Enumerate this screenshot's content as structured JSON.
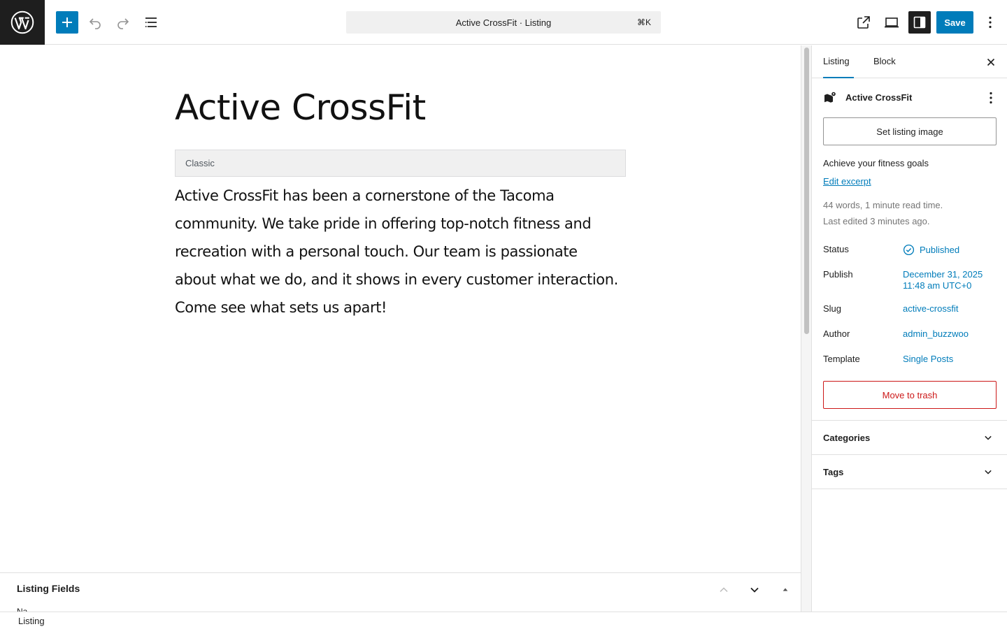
{
  "topbar": {
    "command_title": "Active CrossFit · Listing",
    "command_shortcut": "⌘K",
    "save_label": "Save",
    "icons": {
      "logo": "wordpress-logo-icon",
      "add": "plus-icon",
      "undo": "undo-icon",
      "redo": "redo-icon",
      "list_view": "list-view-icon",
      "view": "external-link-icon",
      "preview": "desktop-icon",
      "settings": "sidebar-settings-icon",
      "more": "vertical-dots-icon"
    }
  },
  "editor": {
    "title": "Active CrossFit",
    "classic_label": "Classic",
    "content": "Active CrossFit has been a cornerstone of the Tacoma community. We take pride in offering top-notch fitness and recreation with a personal touch. Our team is passionate about what we do, and it shows in every customer interaction. Come see what sets us apart!"
  },
  "metabox": {
    "title": "Listing Fields",
    "peek_text": "Na"
  },
  "footer": {
    "breadcrumb": "Listing"
  },
  "sidebar": {
    "tabs": [
      {
        "label": "Listing",
        "active": true
      },
      {
        "label": "Block",
        "active": false
      }
    ],
    "post_name": "Active CrossFit",
    "set_image_label": "Set listing image",
    "excerpt": "Achieve your fitness goals",
    "edit_excerpt_label": "Edit excerpt",
    "stats_words": "44 words, 1 minute read time.",
    "stats_edited": "Last edited 3 minutes ago.",
    "meta": {
      "status_label": "Status",
      "status_value": "Published",
      "publish_label": "Publish",
      "publish_date": "December 31, 2025",
      "publish_time": "11:48 am UTC+0",
      "slug_label": "Slug",
      "slug_value": "active-crossfit",
      "author_label": "Author",
      "author_value": "admin_buzzwoo",
      "template_label": "Template",
      "template_value": "Single Posts"
    },
    "trash_label": "Move to trash",
    "panels": [
      {
        "label": "Categories"
      },
      {
        "label": "Tags"
      }
    ]
  },
  "colors": {
    "accent": "#007cba",
    "danger": "#cc1818",
    "dark": "#1e1e1e",
    "muted": "#757575"
  }
}
